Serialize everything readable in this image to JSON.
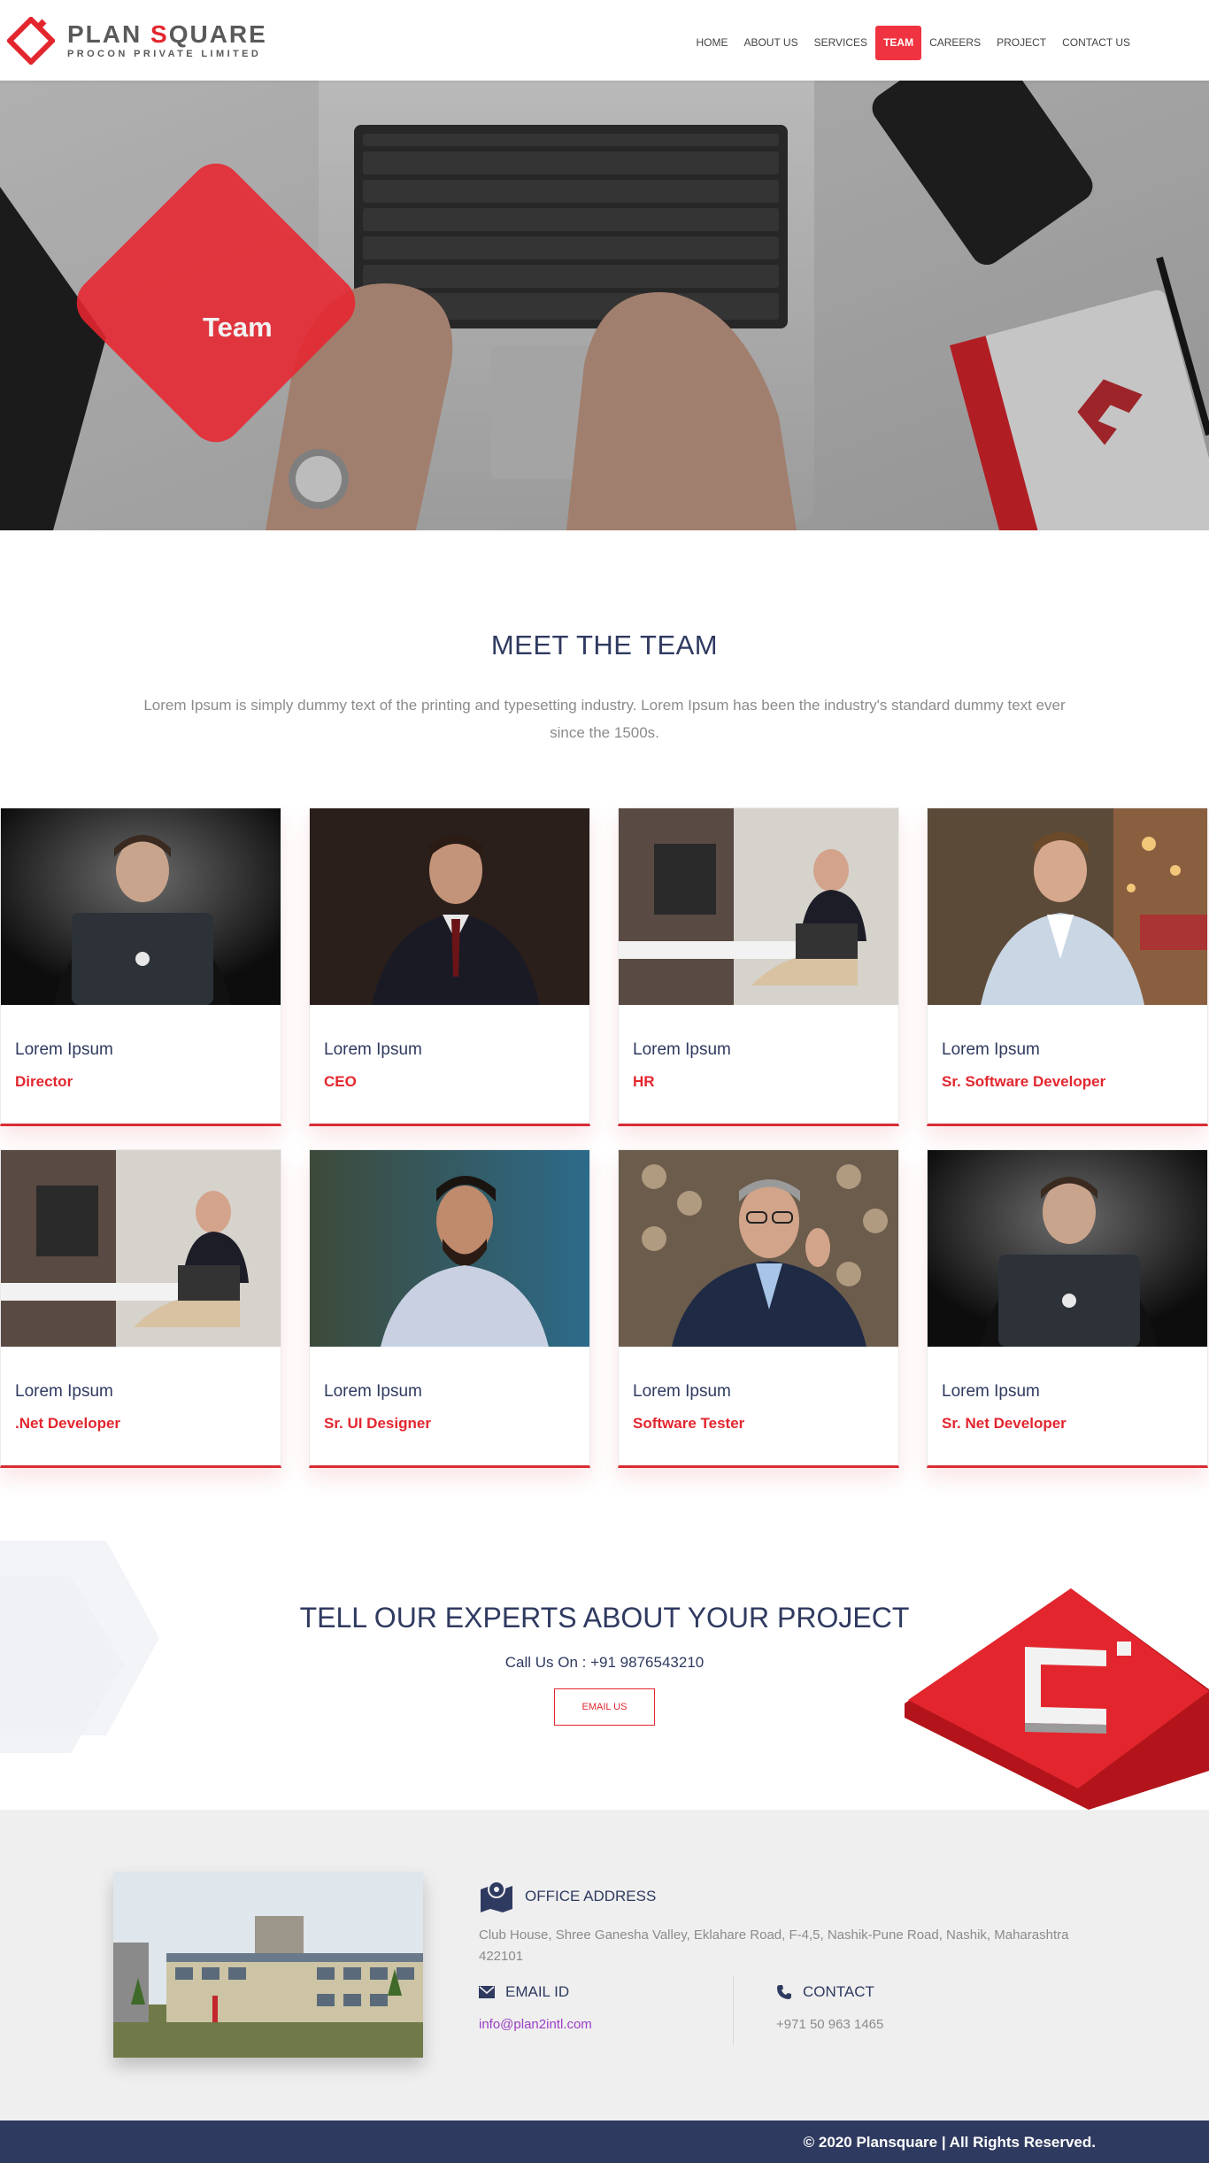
{
  "header": {
    "logo_name_part1": "PLAN ",
    "logo_name_red": "S",
    "logo_name_part2": "QUARE",
    "logo_sub": "PROCON PRIVATE LIMITED",
    "nav": [
      {
        "label": "HOME",
        "active": false
      },
      {
        "label": "ABOUT US",
        "active": false
      },
      {
        "label": "SERVICES",
        "active": false
      },
      {
        "label": "TEAM",
        "active": true
      },
      {
        "label": "CAREERS",
        "active": false
      },
      {
        "label": "PROJECT",
        "active": false
      },
      {
        "label": "CONTACT US",
        "active": false
      }
    ]
  },
  "hero": {
    "title": "Team"
  },
  "team_section": {
    "title": "MEET THE TEAM",
    "description": "Lorem Ipsum is simply dummy text of the printing and typesetting industry. Lorem Ipsum has been the industry's standard dummy text ever since the 1500s.",
    "members": [
      {
        "name": "Lorem Ipsum",
        "role": "Director"
      },
      {
        "name": "Lorem Ipsum",
        "role": "CEO"
      },
      {
        "name": "Lorem Ipsum",
        "role": "HR"
      },
      {
        "name": "Lorem Ipsum",
        "role": "Sr. Software Developer"
      },
      {
        "name": "Lorem Ipsum",
        "role": ".Net Developer"
      },
      {
        "name": "Lorem Ipsum",
        "role": "Sr. UI Designer"
      },
      {
        "name": "Lorem Ipsum",
        "role": "Software Tester"
      },
      {
        "name": "Lorem Ipsum",
        "role": "Sr. Net Developer"
      }
    ]
  },
  "cta": {
    "title": "TELL OUR EXPERTS ABOUT YOUR PROJECT",
    "call": "Call Us On : +91 9876543210",
    "button": "EMAIL US"
  },
  "footer": {
    "office_label": "OFFICE ADDRESS",
    "office_address": "Club House, Shree Ganesha Valley, Eklahare Road, F-4,5, Nashik-Pune Road, Nashik, Maharashtra 422101",
    "email_label": "EMAIL ID",
    "email": "info@plan2intl.com",
    "contact_label": "CONTACT",
    "phone": "+971 50 963 1465",
    "copyright": "© 2020 Plansquare | All Rights Reserved."
  },
  "colors": {
    "accent_red": "#e3262e",
    "navy": "#2f3a60",
    "footer_bar": "#2f3a60"
  }
}
